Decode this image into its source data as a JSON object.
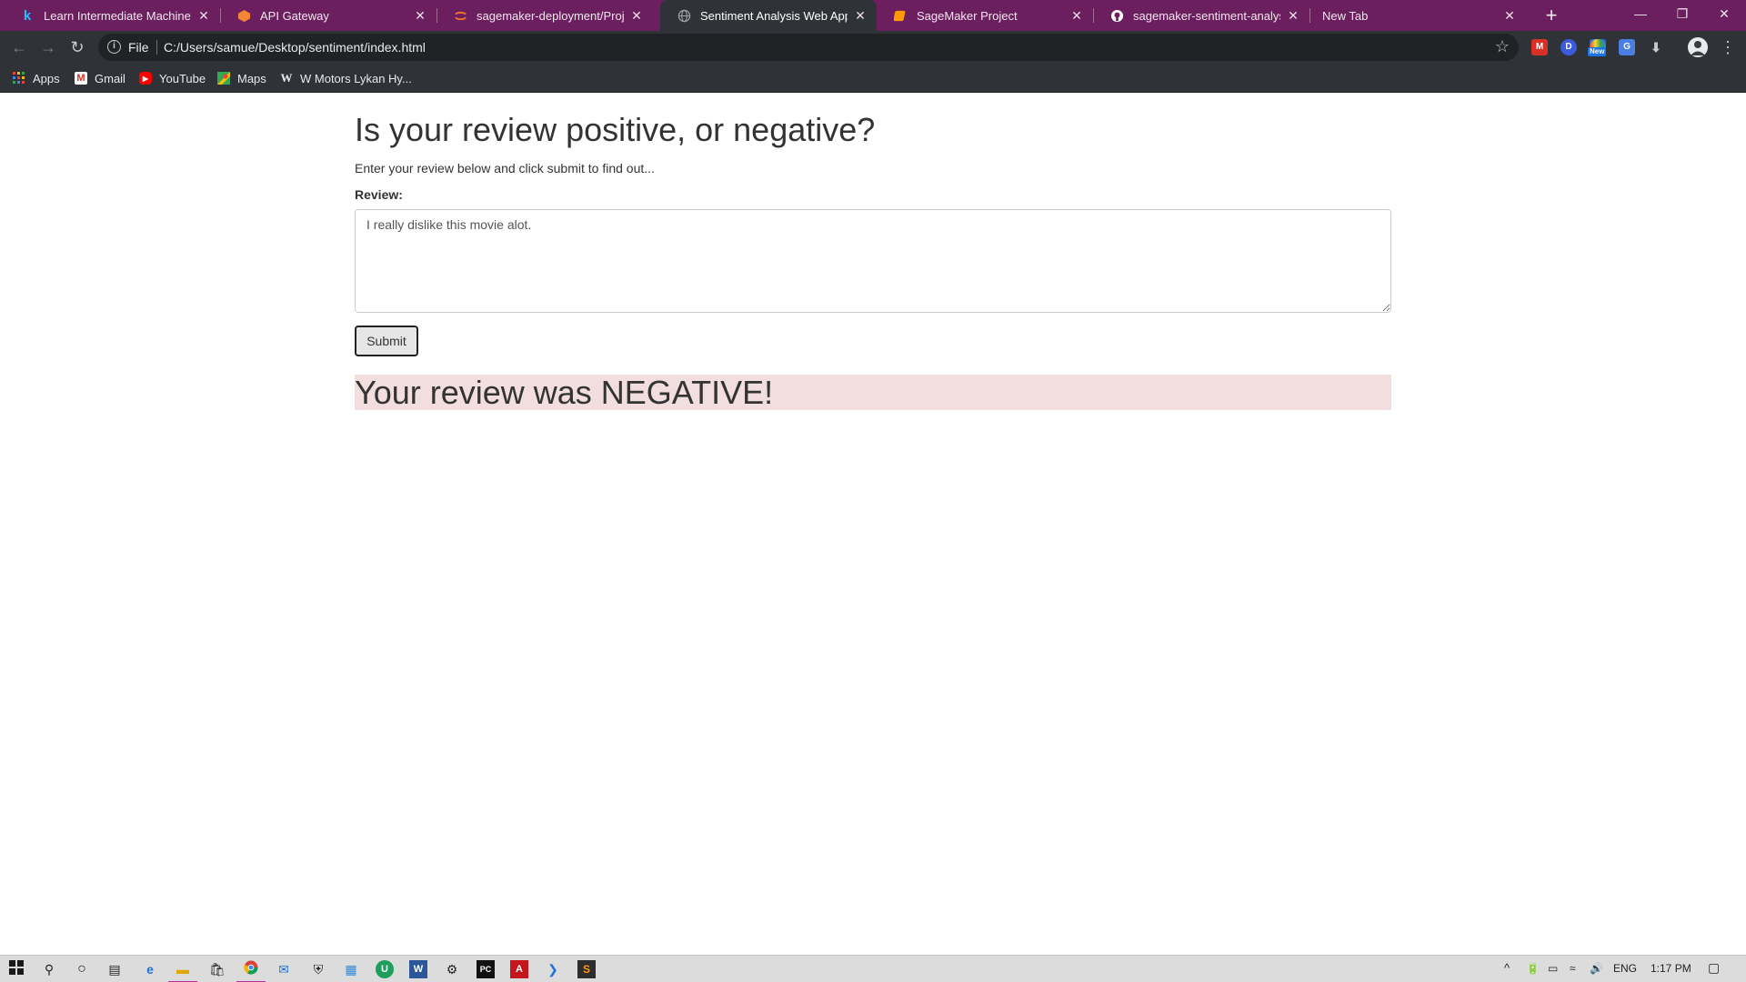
{
  "browser": {
    "tabs": [
      {
        "title": "Learn Intermediate Machine Lear",
        "icon": "kaggle-icon",
        "active": false
      },
      {
        "title": "API Gateway",
        "icon": "aws-icon",
        "active": false
      },
      {
        "title": "sagemaker-deployment/Project/",
        "icon": "jupyter-icon",
        "active": false
      },
      {
        "title": "Sentiment Analysis Web App",
        "icon": "globe-icon",
        "active": true
      },
      {
        "title": "SageMaker Project",
        "icon": "sagemaker-icon",
        "active": false
      },
      {
        "title": "sagemaker-sentiment-analysis/sc",
        "icon": "github-icon",
        "active": false
      },
      {
        "title": "New Tab",
        "icon": "",
        "active": false
      }
    ],
    "new_tab": "+",
    "window_controls": {
      "minimize": "—",
      "restore": "❐",
      "close": "✕"
    },
    "address": {
      "scheme_label": "File",
      "url": "C:/Users/samue/Desktop/sentiment/index.html"
    },
    "bookmarks": [
      {
        "label": "Apps",
        "icon": "apps-grid-icon"
      },
      {
        "label": "Gmail",
        "icon": "gmail-icon"
      },
      {
        "label": "YouTube",
        "icon": "youtube-icon"
      },
      {
        "label": "Maps",
        "icon": "maps-icon"
      },
      {
        "label": "W Motors Lykan Hy...",
        "icon": "wikipedia-icon"
      }
    ],
    "extensions": {
      "badge_new": "New"
    }
  },
  "page": {
    "heading": "Is your review positive, or negative?",
    "lead": "Enter your review below and click submit to find out...",
    "review_label": "Review:",
    "review_value": "I really dislike this movie alot.",
    "submit_label": "Submit",
    "result": "Your review was NEGATIVE!",
    "result_bg": "#f2dede"
  },
  "taskbar": {
    "language": "ENG",
    "time": "1:17 PM"
  },
  "colors": {
    "tabstrip": "#6b1f5e",
    "toolbar": "#2f3337"
  }
}
